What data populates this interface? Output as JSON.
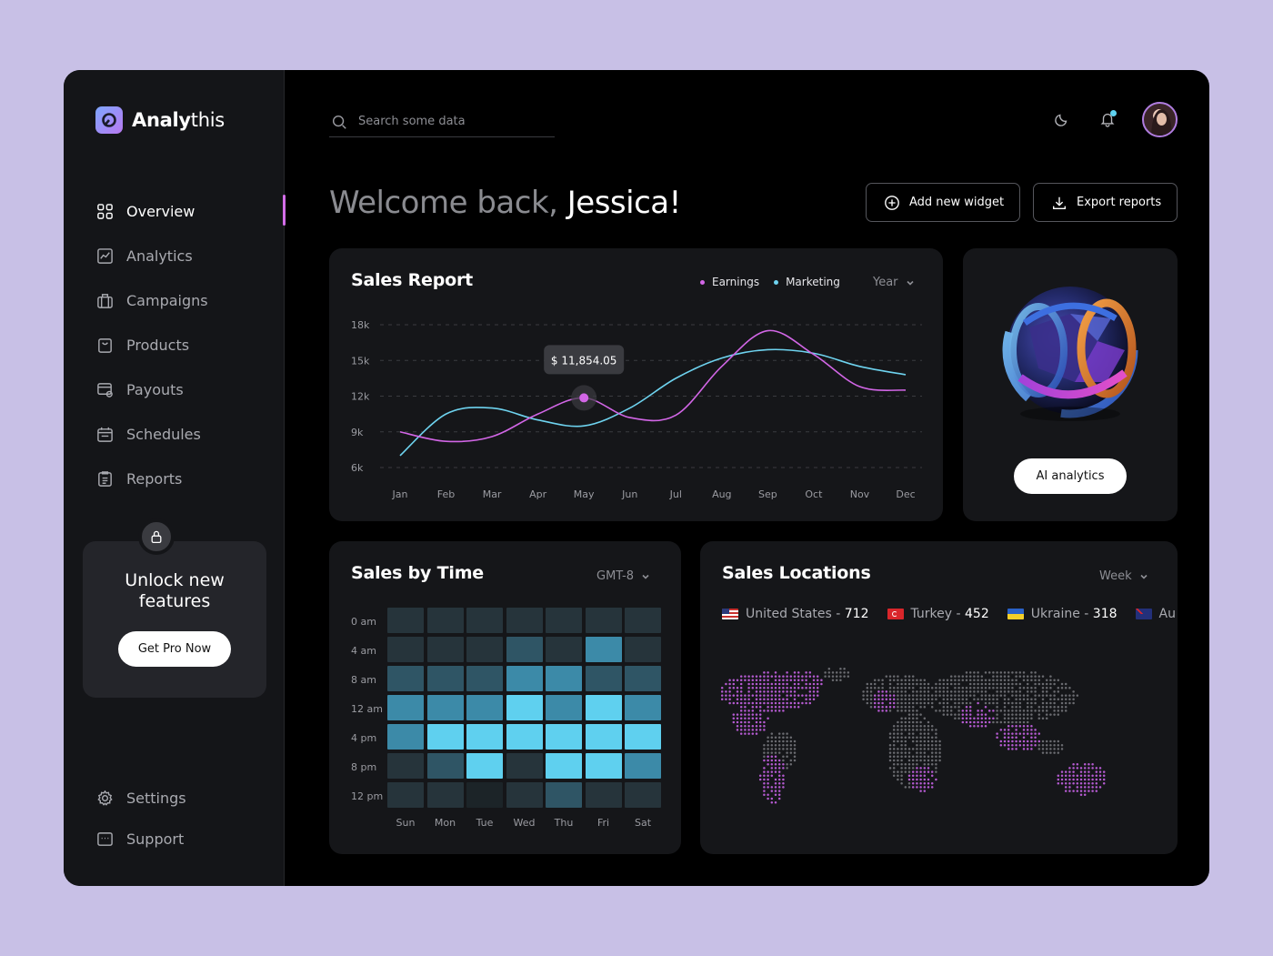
{
  "app": {
    "logo_bold": "Analy",
    "logo_thin": "this"
  },
  "sidebar": {
    "items": [
      {
        "label": "Overview",
        "icon": "grid-icon",
        "active": true
      },
      {
        "label": "Analytics",
        "icon": "chart-icon"
      },
      {
        "label": "Campaigns",
        "icon": "briefcase-icon"
      },
      {
        "label": "Products",
        "icon": "bag-icon"
      },
      {
        "label": "Payouts",
        "icon": "card-icon"
      },
      {
        "label": "Schedules",
        "icon": "calendar-icon"
      },
      {
        "label": "Reports",
        "icon": "clipboard-icon"
      }
    ],
    "promo": {
      "title_line1": "Unlock new",
      "title_line2": "features",
      "button": "Get Pro Now"
    },
    "bottom": [
      {
        "label": "Settings",
        "icon": "gear-icon"
      },
      {
        "label": "Support",
        "icon": "support-icon"
      }
    ]
  },
  "header": {
    "search_placeholder": "Search some data",
    "welcome_prefix": "Welcome back, ",
    "welcome_name": "Jessica!",
    "add_widget": "Add new widget",
    "export": "Export reports"
  },
  "sales_report": {
    "title": "Sales Report",
    "legend": [
      {
        "name": "Earnings",
        "color": "#d266e6"
      },
      {
        "name": "Marketing",
        "color": "#6ed3ef"
      }
    ],
    "period": "Year",
    "tooltip": "$ 11,854.05"
  },
  "chart_data": {
    "type": "line",
    "x": [
      "Jan",
      "Feb",
      "Mar",
      "Apr",
      "May",
      "Jun",
      "Jul",
      "Aug",
      "Sep",
      "Oct",
      "Nov",
      "Dec"
    ],
    "y_ticks": [
      "18k",
      "15k",
      "12k",
      "9k",
      "6k"
    ],
    "ylim": [
      6000,
      18000
    ],
    "series": [
      {
        "name": "Earnings",
        "color": "#d266e6",
        "values": [
          9000,
          8200,
          8600,
          10500,
          11854,
          10200,
          10400,
          14500,
          17500,
          15500,
          12800,
          12500
        ]
      },
      {
        "name": "Marketing",
        "color": "#6ed3ef",
        "values": [
          7000,
          10500,
          11000,
          10000,
          9500,
          11000,
          13500,
          15200,
          15900,
          15600,
          14500,
          13800
        ]
      }
    ]
  },
  "ai_card": {
    "button": "AI analytics"
  },
  "sales_by_time": {
    "title": "Sales by Time",
    "timezone": "GMT-8",
    "rows": [
      "0 am",
      "4 am",
      "8 am",
      "12 am",
      "4 pm",
      "8 pm",
      "12 pm"
    ],
    "cols": [
      "Sun",
      "Mon",
      "Tue",
      "Wed",
      "Thu",
      "Fri",
      "Sat"
    ],
    "levels": [
      [
        1,
        1,
        1,
        1,
        1,
        1,
        1
      ],
      [
        1,
        1,
        1,
        2,
        1,
        3,
        1
      ],
      [
        2,
        2,
        2,
        3,
        3,
        2,
        2
      ],
      [
        3,
        3,
        3,
        4,
        3,
        4,
        3
      ],
      [
        3,
        4,
        4,
        4,
        4,
        4,
        4
      ],
      [
        1,
        2,
        4,
        1,
        4,
        4,
        3
      ],
      [
        1,
        1,
        0,
        1,
        2,
        1,
        1
      ]
    ],
    "colors": [
      "#1c2428",
      "#26343b",
      "#2f5565",
      "#3c8aa8",
      "#5fd0ef"
    ]
  },
  "sales_locations": {
    "title": "Sales Locations",
    "period": "Week",
    "items": [
      {
        "country": "United States",
        "value": "712",
        "flag": "us-flag"
      },
      {
        "country": "Turkey",
        "value": "452",
        "flag": "tr-flag"
      },
      {
        "country": "Ukraine",
        "value": "318",
        "flag": "ua-flag"
      },
      {
        "country": "Au",
        "value": "",
        "flag": "au-flag"
      }
    ]
  }
}
